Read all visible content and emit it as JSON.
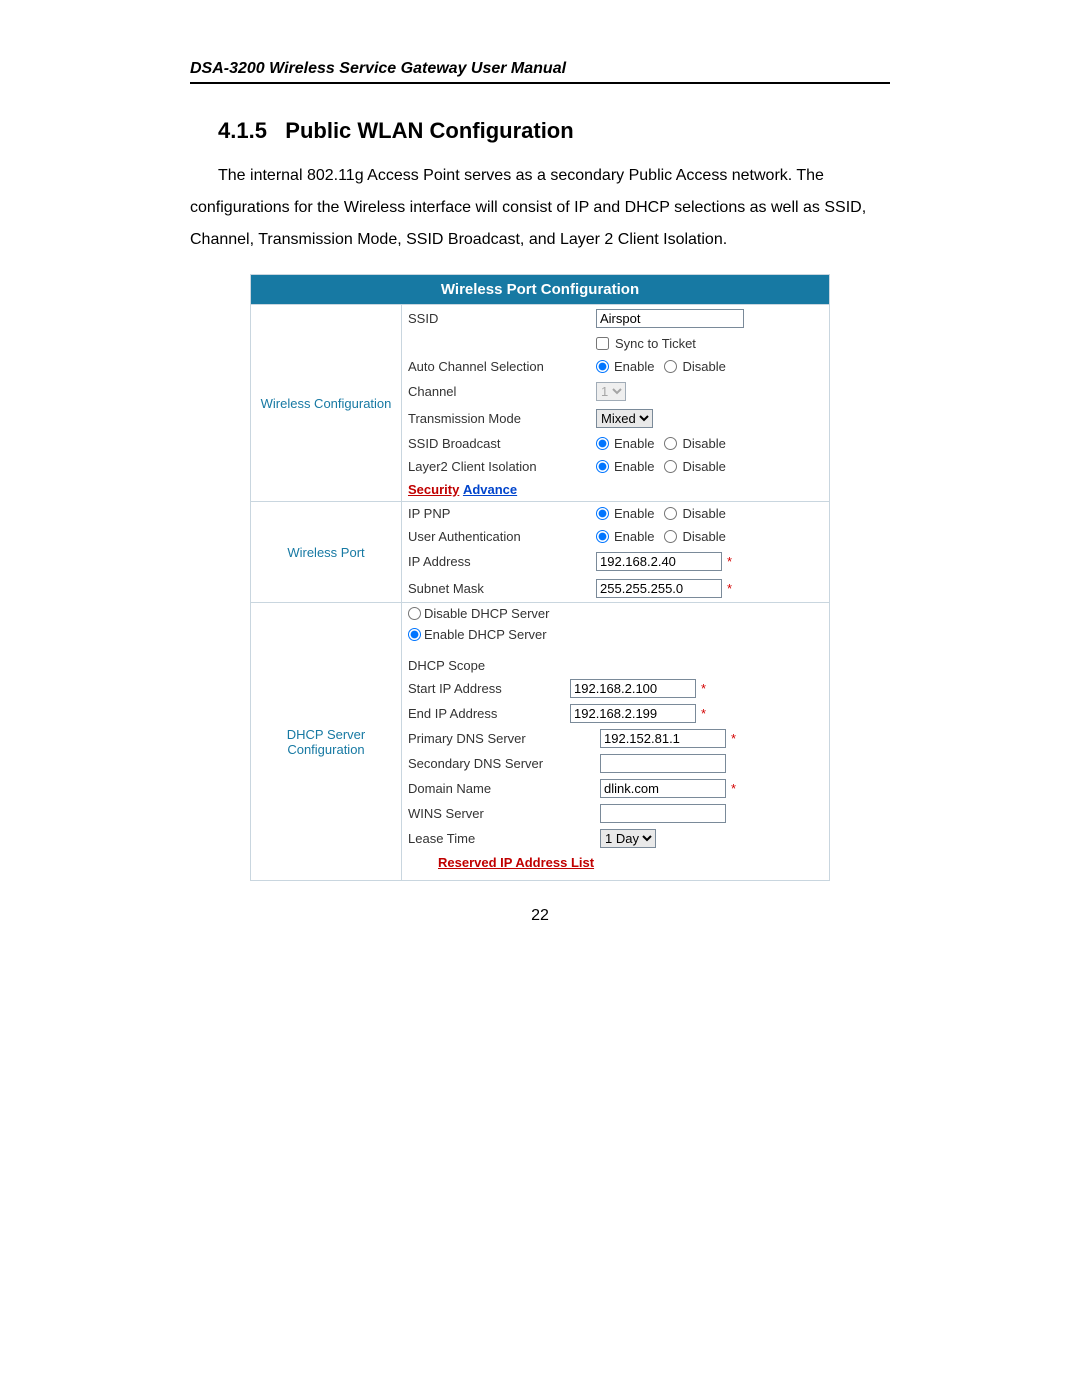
{
  "doc": {
    "header": "DSA-3200 Wireless Service Gateway User Manual",
    "section_no": "4.1.5",
    "section_title": "Public WLAN Configuration",
    "body": "The internal 802.11g Access Point serves as a secondary Public Access network. The configurations for the Wireless interface will consist of IP and DHCP selections as well as SSID, Channel, Transmission Mode, SSID Broadcast, and Layer 2 Client Isolation.",
    "page_number": "22"
  },
  "panel_title": "Wireless Port Configuration",
  "labels": {
    "enable": "Enable",
    "disable": "Disable"
  },
  "sec1": {
    "title": "Wireless Configuration",
    "ssid_label": "SSID",
    "ssid_value": "Airspot",
    "sync_label": "Sync to Ticket",
    "auto_channel_label": "Auto Channel Selection",
    "channel_label": "Channel",
    "channel_value": "1",
    "trans_mode_label": "Transmission Mode",
    "trans_mode_value": "Mixed",
    "ssid_broadcast_label": "SSID Broadcast",
    "l2_iso_label": "Layer2 Client Isolation",
    "link_security": "Security",
    "link_advance": "Advance"
  },
  "sec2": {
    "title": "Wireless Port",
    "ip_pnp_label": "IP PNP",
    "user_auth_label": "User Authentication",
    "ip_addr_label": "IP Address",
    "ip_addr_value": "192.168.2.40",
    "subnet_label": "Subnet Mask",
    "subnet_value": "255.255.255.0"
  },
  "sec3": {
    "title": "DHCP Server Configuration",
    "disable_label": "Disable DHCP Server",
    "enable_label": "Enable DHCP Server",
    "scope_label": "DHCP Scope",
    "start_ip_label": "Start IP Address",
    "start_ip_value": "192.168.2.100",
    "end_ip_label": "End  IP Address",
    "end_ip_value": "192.168.2.199",
    "primary_dns_label": "Primary DNS Server",
    "primary_dns_value": "192.152.81.1",
    "secondary_dns_label": "Secondary DNS Server",
    "secondary_dns_value": "",
    "domain_label": "Domain Name",
    "domain_value": "dlink.com",
    "wins_label": "WINS Server",
    "wins_value": "",
    "lease_label": "Lease Time",
    "lease_value": "1 Day",
    "link_reserved": "Reserved IP Address List"
  }
}
